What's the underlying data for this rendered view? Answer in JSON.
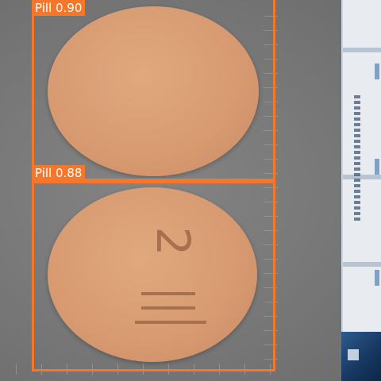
{
  "detections": [
    {
      "label": "Pill",
      "score": "0.90"
    },
    {
      "label": "Pill",
      "score": "0.88"
    }
  ],
  "imprint": "2",
  "colors": {
    "box": "#f4772c",
    "pill": "#d89b72",
    "background": "#7a7a7a"
  }
}
